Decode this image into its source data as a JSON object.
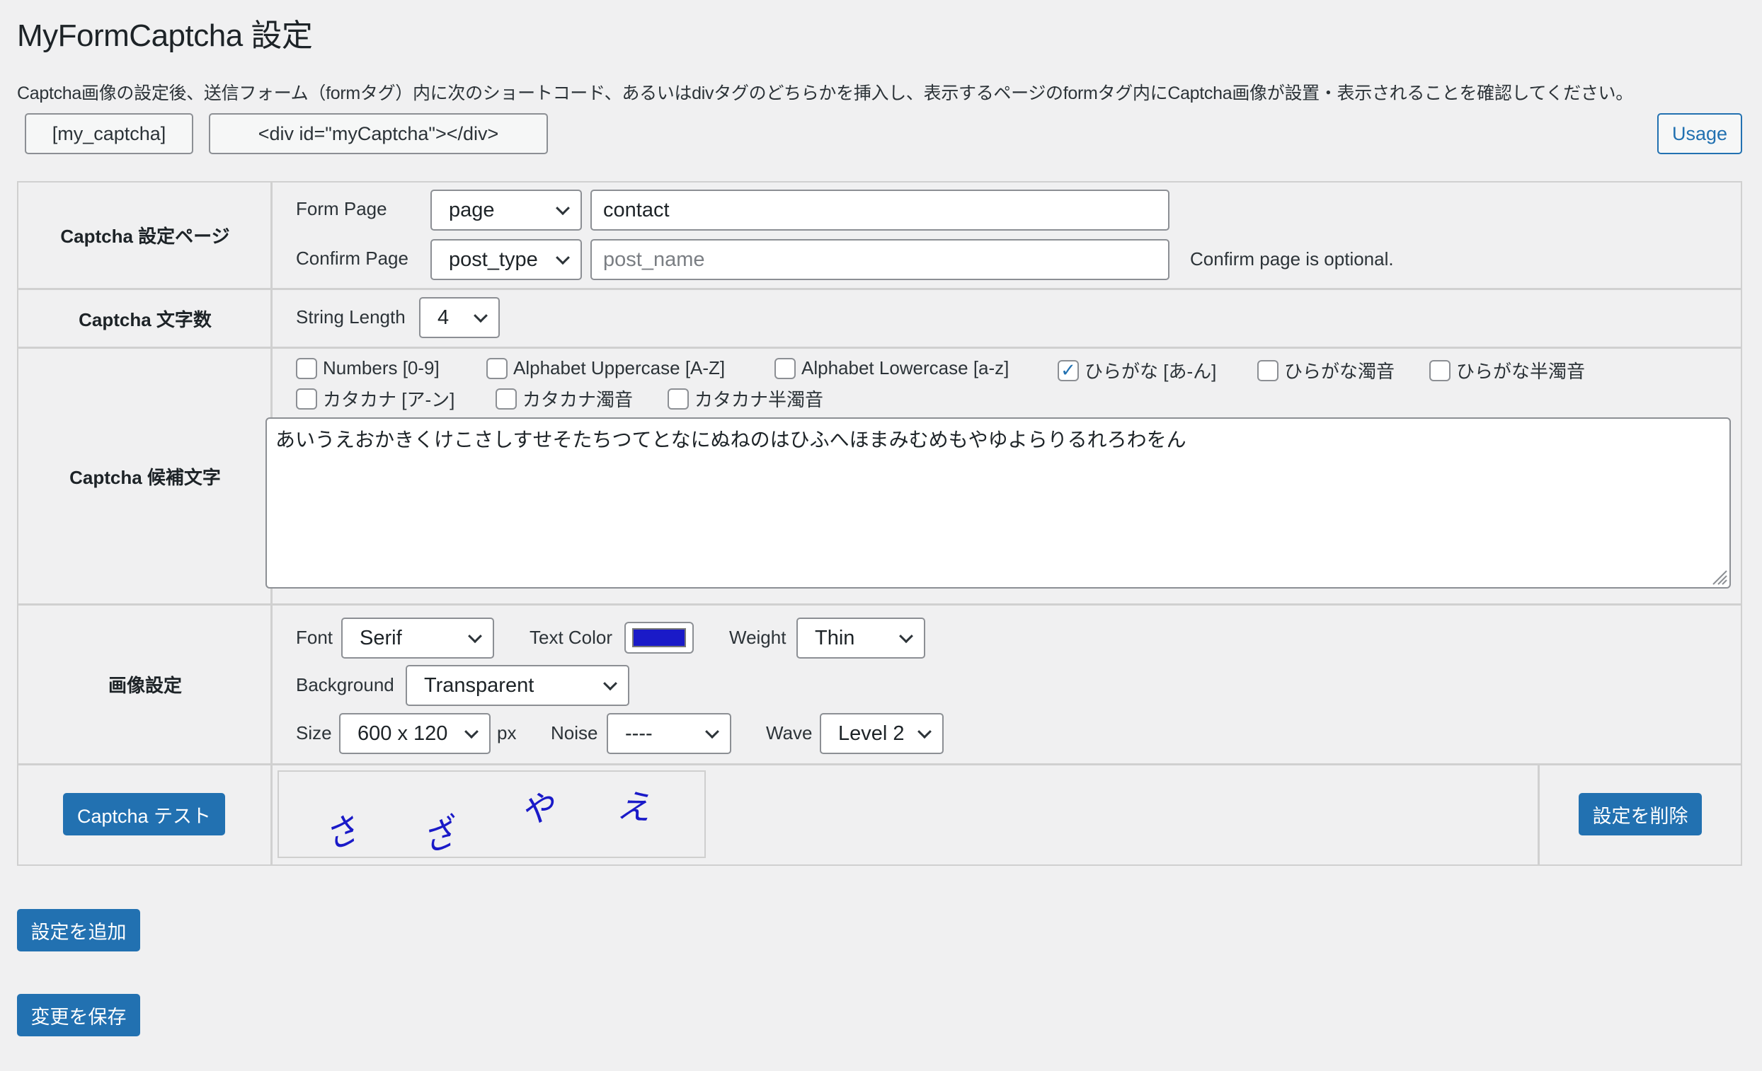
{
  "page": {
    "title": "MyFormCaptcha 設定",
    "description": "Captcha画像の設定後、送信フォーム（formタグ）内に次のショートコード、あるいはdivタグのどちらかを挿入し、表示するページのformタグ内にCaptcha画像が設置・表示されることを確認してください。"
  },
  "shortcodes": {
    "shortcode_label": "[my_captcha]",
    "div_label": "<div id=\"myCaptcha\"></div>",
    "usage_label": "Usage"
  },
  "settings": {
    "page_row": {
      "label": "Captcha 設定ページ",
      "form_page_label": "Form Page",
      "form_page_type": "page",
      "form_page_value": "contact",
      "confirm_page_label": "Confirm Page",
      "confirm_page_type": "post_type",
      "confirm_page_placeholder": "post_name",
      "confirm_note": "Confirm page is optional."
    },
    "length_row": {
      "label": "Captcha 文字数",
      "string_length_label": "String Length",
      "string_length_value": "4"
    },
    "chars_row": {
      "label": "Captcha 候補文字",
      "options": [
        {
          "label": "Numbers [0-9]",
          "checked": false
        },
        {
          "label": "Alphabet Uppercase [A-Z]",
          "checked": false
        },
        {
          "label": "Alphabet Lowercase [a-z]",
          "checked": false
        },
        {
          "label": "ひらがな [あ-ん]",
          "checked": true
        },
        {
          "label": "ひらがな濁音",
          "checked": false
        },
        {
          "label": "ひらがな半濁音",
          "checked": false
        },
        {
          "label": "カタカナ [ア-ン]",
          "checked": false
        },
        {
          "label": "カタカナ濁音",
          "checked": false
        },
        {
          "label": "カタカナ半濁音",
          "checked": false
        }
      ],
      "check_mark": "✓",
      "characters": "あいうえおかきくけこさしすせそたちつてとなにぬねのはひふへほまみむめもやゆよらりるれろわをん"
    },
    "image_row": {
      "label": "画像設定",
      "font_label": "Font",
      "font_value": "Serif",
      "text_color_label": "Text Color",
      "text_color": "#1a1ac8",
      "weight_label": "Weight",
      "weight_value": "Thin",
      "background_label": "Background",
      "background_value": "Transparent",
      "size_label": "Size",
      "size_value": "600 x 120",
      "size_unit": "px",
      "noise_label": "Noise",
      "noise_value": "----",
      "wave_label": "Wave",
      "wave_value": "Level 2"
    },
    "test_row": {
      "test_button": "Captcha テスト",
      "captcha_chars": [
        "さ",
        "ざ",
        "や",
        "え"
      ],
      "delete_button": "設定を削除"
    }
  },
  "actions": {
    "add_setting": "設定を追加",
    "save_changes": "変更を保存"
  },
  "colors": {
    "primary": "#2271b1",
    "background": "#f0f0f1",
    "captcha_text": "#1a1ac8"
  }
}
